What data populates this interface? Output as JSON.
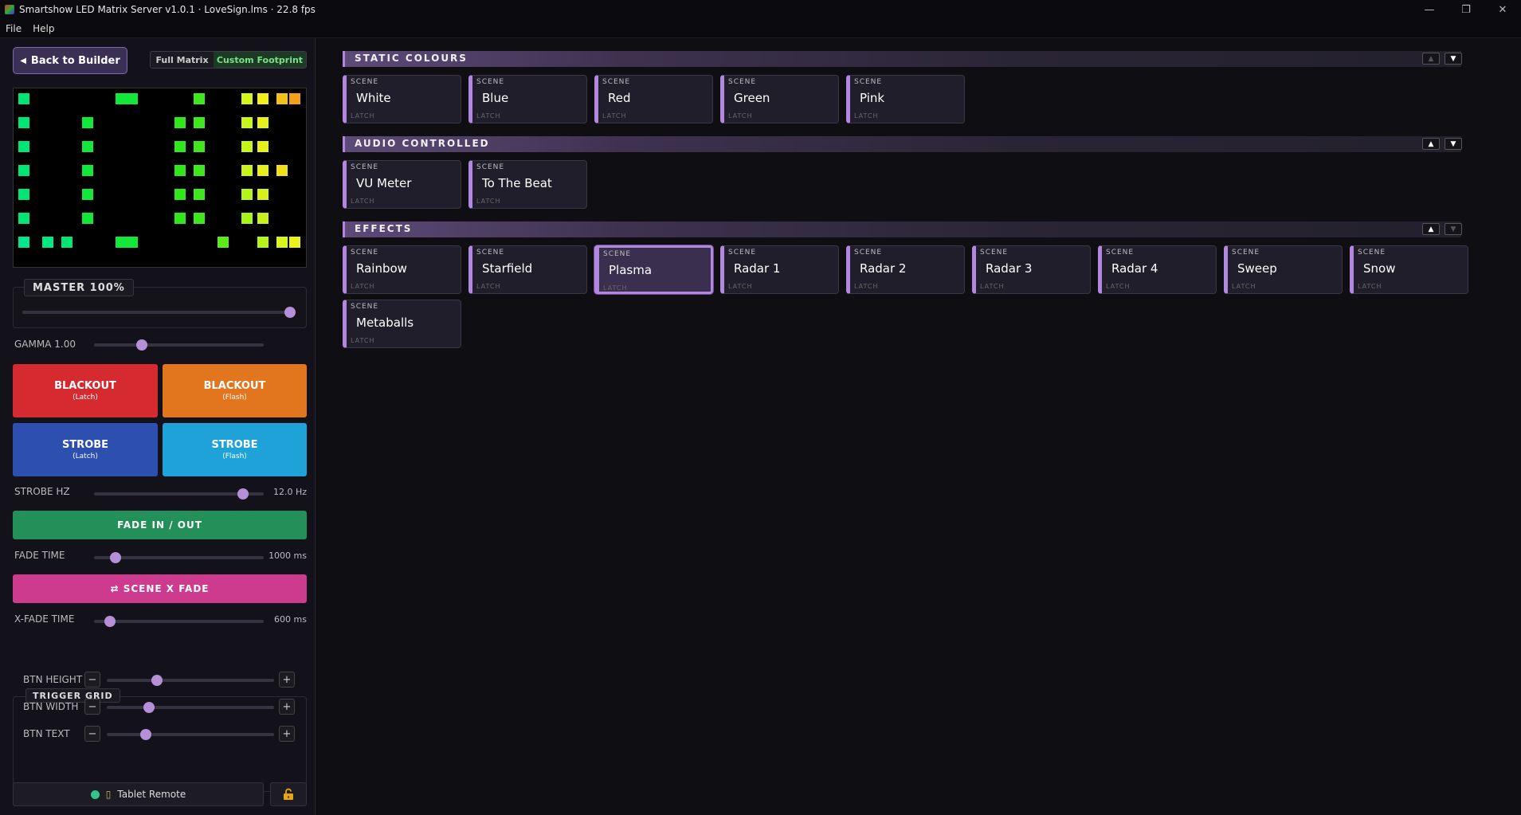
{
  "window": {
    "title": "Smartshow LED Matrix Server v1.0.1 · LoveSign.lms · 22.8 fps",
    "minimize_glyph": "—",
    "restore_glyph": "❐",
    "close_glyph": "✕"
  },
  "menu": {
    "file": "File",
    "help": "Help"
  },
  "left": {
    "back_button": "Back to Builder",
    "back_arrow": "◀",
    "mode_full": "Full Matrix",
    "mode_custom": "Custom Footprint",
    "master_label": "MASTER 100%",
    "master_value": 100,
    "gamma_label": "GAMMA 1.00",
    "gamma_value": 1.0,
    "blackout_latch": "BLACKOUT",
    "blackout_latch_sub": "(Latch)",
    "blackout_flash": "BLACKOUT",
    "blackout_flash_sub": "(Flash)",
    "strobe_latch": "STROBE",
    "strobe_latch_sub": "(Latch)",
    "strobe_flash": "STROBE",
    "strobe_flash_sub": "(Flash)",
    "strobe_hz_label": "STROBE HZ",
    "strobe_hz_value": "12.0 Hz",
    "fade_button": "FADE IN / OUT",
    "fade_time_label": "FADE TIME",
    "fade_time_value": "1000 ms",
    "xfade_button": "⇄ SCENE X FADE",
    "xfade_time_label": "X-FADE TIME",
    "xfade_time_value": "600 ms",
    "trigger_grid_label": "TRIGGER GRID",
    "btn_height_label": "BTN HEIGHT",
    "btn_width_label": "BTN WIDTH",
    "btn_text_label": "BTN TEXT",
    "minus": "−",
    "plus": "+",
    "tablet_remote": "Tablet Remote",
    "tablet_icon": "▯"
  },
  "sections": {
    "static": {
      "title": "STATIC COLOURS",
      "up": "▲",
      "down": "▼"
    },
    "audio": {
      "title": "AUDIO CONTROLLED",
      "up": "▲",
      "down": "▼"
    },
    "effects": {
      "title": "EFFECTS",
      "up": "▲",
      "down": "▼"
    }
  },
  "scene_tag": "SCENE",
  "latch_tag": "LATCH",
  "scenes": {
    "static": [
      "White",
      "Blue",
      "Red",
      "Green",
      "Pink"
    ],
    "audio": [
      "VU Meter",
      "To The Beat"
    ],
    "effects": [
      "Rainbow",
      "Starfield",
      "Plasma",
      "Radar 1",
      "Radar 2",
      "Radar 3",
      "Radar 4",
      "Sweep",
      "Snow",
      "Metaballs"
    ]
  },
  "active_scene": "Plasma",
  "colors": {
    "accent": "#b287e0",
    "blackout_latch": "#d52b30",
    "blackout_flash": "#e2761f",
    "strobe_latch": "#2c4fb0",
    "strobe_flash": "#1fa2d8",
    "fade": "#23905a",
    "xfade": "#cc3b8e"
  }
}
